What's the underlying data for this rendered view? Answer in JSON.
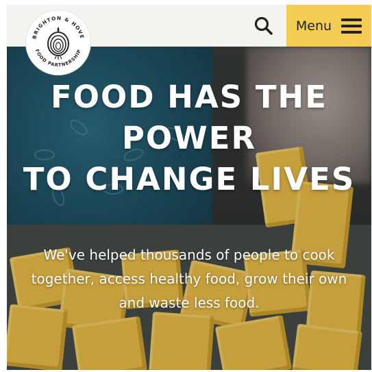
{
  "header": {
    "menu_label": "Menu",
    "search_icon": "search-icon",
    "menu_icon": "hamburger-icon",
    "logo_text": "BRIGHTON & HOVE FOOD PARTNERSHIP",
    "accent_color": "#f5cd55"
  },
  "hero": {
    "headline": [
      "FOOD HAS THE",
      "POWER",
      "TO CHANGE LIVES"
    ],
    "subcopy": "We've helped thousands of people to cook together, access healthy food, grow their own and waste less food."
  }
}
